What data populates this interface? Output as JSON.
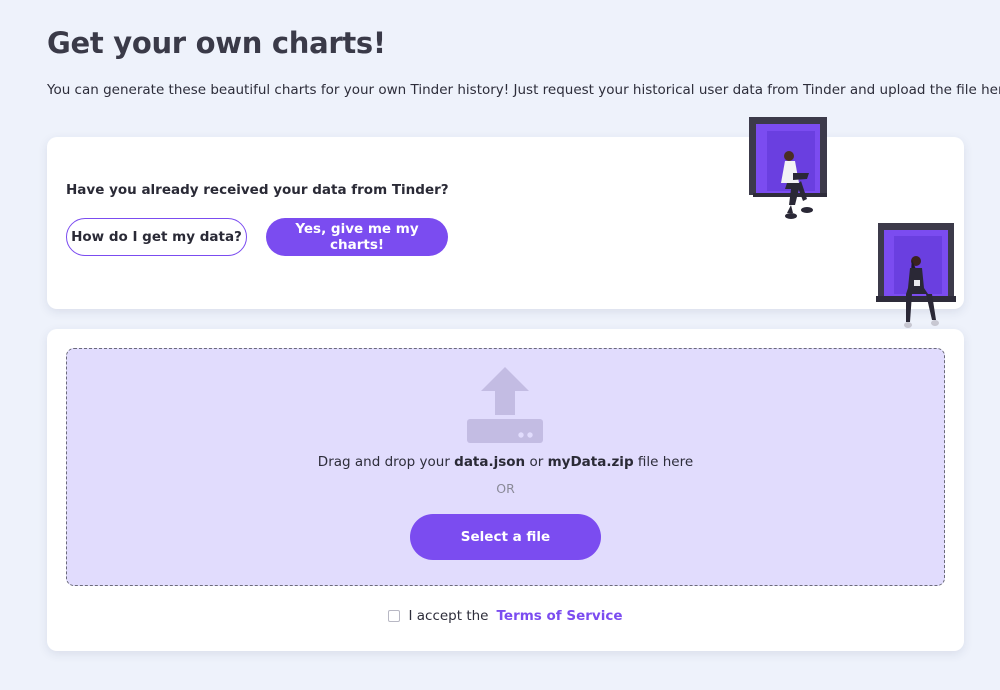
{
  "header": {
    "title": "Get your own charts!",
    "intro": "You can generate these beautiful charts for your own Tinder history! Just request your historical user data from Tinder and upload the file here!"
  },
  "question_card": {
    "question": "Have you already received your data from Tinder?",
    "how_button": "How do I get my data?",
    "yes_button": "Yes, give me my charts!"
  },
  "upload": {
    "drop_prefix": "Drag and drop your ",
    "file1": "data.json",
    "drop_mid": " or ",
    "file2": "myData.zip",
    "drop_suffix": " file here",
    "or_label": "OR",
    "select_button": "Select a file"
  },
  "terms": {
    "prefix": "I accept the",
    "link": "Terms of Service",
    "checked": false
  },
  "icons": {
    "upload": "upload-icon"
  },
  "colors": {
    "accent": "#7b4cf0",
    "dropzone": "#e1dcfd",
    "background": "#eef2fb"
  }
}
